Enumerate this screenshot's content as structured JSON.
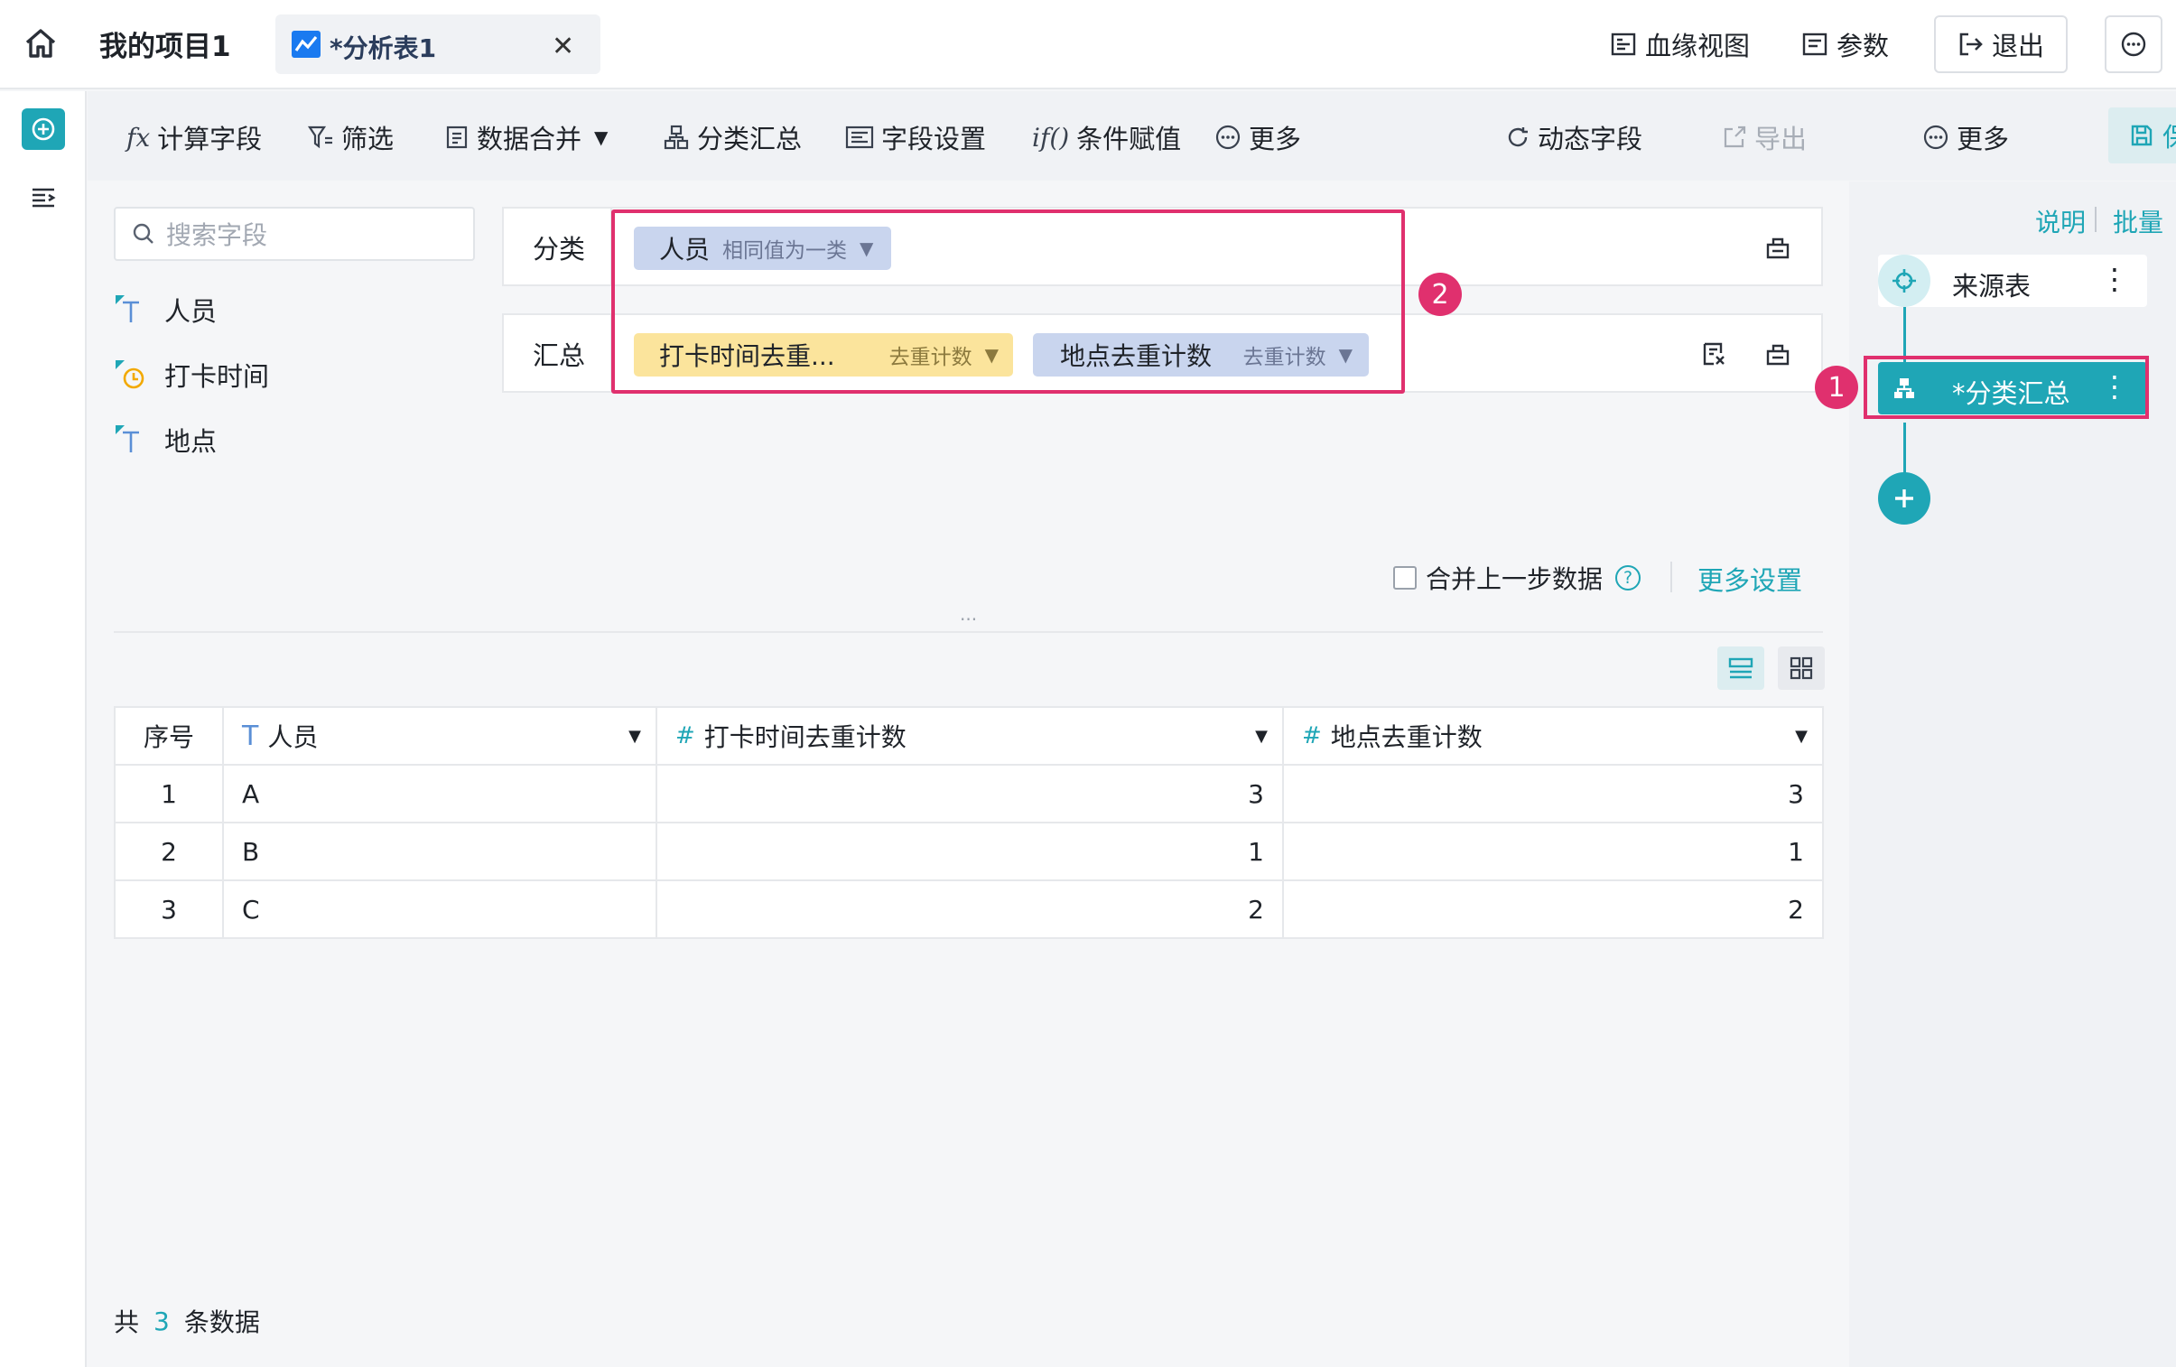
{
  "topbar": {
    "project_title": "我的项目1",
    "tab_label": "*分析表1",
    "close_glyph": "✕",
    "lineage_label": "血缘视图",
    "params_label": "参数",
    "exit_label": "退出"
  },
  "toolbar": {
    "calc_field": "计算字段",
    "filter": "筛选",
    "merge": "数据合并",
    "group_summary": "分类汇总",
    "field_settings": "字段设置",
    "conditional": "条件赋值",
    "more_left": "更多",
    "dynamic_field": "动态字段",
    "export": "导出",
    "more_right": "更多",
    "save": "保存"
  },
  "fields": {
    "search_placeholder": "搜索字段",
    "items": [
      "人员",
      "打卡时间",
      "地点"
    ]
  },
  "config": {
    "group_label": "分类",
    "summary_label": "汇总",
    "group_pill": {
      "name": "人员",
      "mode": "相同值为一类"
    },
    "summary_pills": [
      {
        "name": "打卡时间去重...",
        "mode": "去重计数"
      },
      {
        "name": "地点去重计数",
        "mode": "去重计数"
      }
    ],
    "merge_prev_label": "合并上一步数据",
    "more_settings": "更多设置",
    "ellipsis": "...",
    "annotation_1": "1",
    "annotation_2": "2"
  },
  "table": {
    "headers": [
      "序号",
      "人员",
      "打卡时间去重计数",
      "地点去重计数"
    ],
    "rows": [
      [
        "1",
        "A",
        "3",
        "3"
      ],
      [
        "2",
        "B",
        "1",
        "1"
      ],
      [
        "3",
        "C",
        "2",
        "2"
      ]
    ]
  },
  "footer": {
    "prefix": "共",
    "count": "3",
    "suffix": "条数据"
  },
  "steps": {
    "explain": "说明",
    "batch": "批量",
    "source": "来源表",
    "current": "*分类汇总"
  },
  "colors": {
    "accent": "#1fa6b6",
    "annotation": "#e0306e"
  }
}
